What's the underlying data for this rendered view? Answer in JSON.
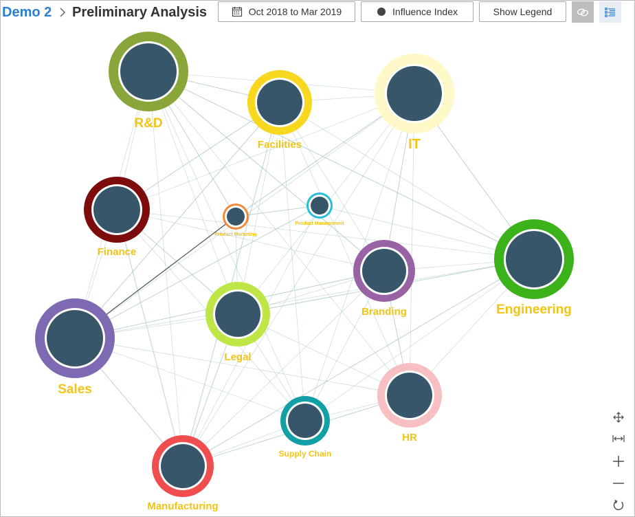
{
  "breadcrumb": {
    "root": "Demo 2",
    "separator_icon": "chevron-right-icon",
    "title": "Preliminary Analysis"
  },
  "toolbar": {
    "date_range_label": "Oct 2018 to Mar 2019",
    "date_icon": "calendar-icon",
    "metric_label": "Influence Index",
    "metric_icon": "filled-circle-icon",
    "legend_label": "Show Legend",
    "link_icon": "link-icon",
    "list_icon": "list-view-icon"
  },
  "colors": {
    "node_fill": "#37566a",
    "label": "#f2c416",
    "edge": "#9fbfbf",
    "breadcrumb_link": "#2a7fd4"
  },
  "graph": {
    "nodes": [
      {
        "id": "rd",
        "label": "R&D",
        "ring_color": "#8aa53a"
      },
      {
        "id": "facilities",
        "label": "Facilities",
        "ring_color": "#f7d81f"
      },
      {
        "id": "it",
        "label": "IT",
        "ring_color": "#fff8c8"
      },
      {
        "id": "finance",
        "label": "Finance",
        "ring_color": "#7d0c0c"
      },
      {
        "id": "product_marketing",
        "label": "Product Marketing",
        "ring_color": "#f08a3a"
      },
      {
        "id": "product_management",
        "label": "Product Management",
        "ring_color": "#24bed6"
      },
      {
        "id": "engineering",
        "label": "Engineering",
        "ring_color": "#3cb21a"
      },
      {
        "id": "branding",
        "label": "Branding",
        "ring_color": "#9862a4"
      },
      {
        "id": "legal",
        "label": "Legal",
        "ring_color": "#bde646"
      },
      {
        "id": "sales",
        "label": "Sales",
        "ring_color": "#7e6ab2"
      },
      {
        "id": "hr",
        "label": "HR",
        "ring_color": "#f7bfc2"
      },
      {
        "id": "supply_chain",
        "label": "Supply Chain",
        "ring_color": "#12a0a6"
      },
      {
        "id": "manufacturing",
        "label": "Manufacturing",
        "ring_color": "#f04e4e"
      }
    ],
    "edges": [
      [
        "rd",
        "facilities"
      ],
      [
        "rd",
        "it"
      ],
      [
        "rd",
        "finance"
      ],
      [
        "rd",
        "engineering"
      ],
      [
        "rd",
        "legal"
      ],
      [
        "rd",
        "sales"
      ],
      [
        "rd",
        "branding"
      ],
      [
        "rd",
        "supply_chain"
      ],
      [
        "rd",
        "manufacturing"
      ],
      [
        "rd",
        "product_marketing"
      ],
      [
        "rd",
        "hr"
      ],
      [
        "facilities",
        "it"
      ],
      [
        "facilities",
        "finance"
      ],
      [
        "facilities",
        "engineering"
      ],
      [
        "facilities",
        "legal"
      ],
      [
        "facilities",
        "sales"
      ],
      [
        "facilities",
        "branding"
      ],
      [
        "facilities",
        "supply_chain"
      ],
      [
        "facilities",
        "manufacturing"
      ],
      [
        "facilities",
        "hr"
      ],
      [
        "it",
        "finance"
      ],
      [
        "it",
        "engineering"
      ],
      [
        "it",
        "legal"
      ],
      [
        "it",
        "sales"
      ],
      [
        "it",
        "branding"
      ],
      [
        "it",
        "supply_chain"
      ],
      [
        "it",
        "manufacturing"
      ],
      [
        "it",
        "product_marketing"
      ],
      [
        "it",
        "hr"
      ],
      [
        "finance",
        "engineering"
      ],
      [
        "finance",
        "legal"
      ],
      [
        "finance",
        "sales"
      ],
      [
        "finance",
        "branding"
      ],
      [
        "finance",
        "manufacturing"
      ],
      [
        "finance",
        "supply_chain"
      ],
      [
        "product_marketing",
        "sales"
      ],
      [
        "product_marketing",
        "product_management"
      ],
      [
        "product_marketing",
        "legal"
      ],
      [
        "product_management",
        "engineering"
      ],
      [
        "product_management",
        "sales"
      ],
      [
        "product_management",
        "manufacturing"
      ],
      [
        "engineering",
        "branding"
      ],
      [
        "engineering",
        "legal"
      ],
      [
        "engineering",
        "sales"
      ],
      [
        "engineering",
        "supply_chain"
      ],
      [
        "engineering",
        "manufacturing"
      ],
      [
        "engineering",
        "hr"
      ],
      [
        "branding",
        "legal"
      ],
      [
        "branding",
        "sales"
      ],
      [
        "branding",
        "supply_chain"
      ],
      [
        "branding",
        "manufacturing"
      ],
      [
        "branding",
        "hr"
      ],
      [
        "legal",
        "sales"
      ],
      [
        "legal",
        "supply_chain"
      ],
      [
        "legal",
        "manufacturing"
      ],
      [
        "legal",
        "hr"
      ],
      [
        "sales",
        "supply_chain"
      ],
      [
        "sales",
        "manufacturing"
      ],
      [
        "sales",
        "hr"
      ],
      [
        "hr",
        "supply_chain"
      ],
      [
        "hr",
        "manufacturing"
      ],
      [
        "supply_chain",
        "manufacturing"
      ]
    ]
  },
  "controls": {
    "pan_icon": "move-arrows-icon",
    "fit_icon": "fit-width-icon",
    "zoom_in_icon": "plus-icon",
    "zoom_out_icon": "minus-icon",
    "reset_icon": "refresh-icon"
  }
}
